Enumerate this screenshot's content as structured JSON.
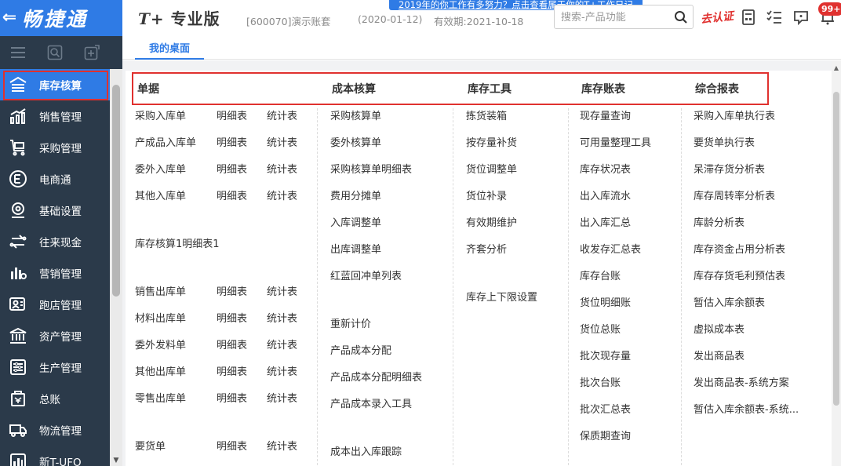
{
  "sidebar": {
    "logo_text": "畅捷通",
    "back_glyph": "⇐",
    "menu_items": [
      {
        "label": "库存核算",
        "icon": "warehouse-icon",
        "active": true
      },
      {
        "label": "销售管理",
        "icon": "sales-chart-icon",
        "active": false
      },
      {
        "label": "采购管理",
        "icon": "cart-icon",
        "active": false
      },
      {
        "label": "电商通",
        "icon": "ecommerce-icon",
        "active": false
      },
      {
        "label": "基础设置",
        "icon": "settings-icon",
        "active": false
      },
      {
        "label": "往来现金",
        "icon": "transfer-icon",
        "active": false
      },
      {
        "label": "营销管理",
        "icon": "marketing-icon",
        "active": false
      },
      {
        "label": "跑店管理",
        "icon": "store-visit-icon",
        "active": false
      },
      {
        "label": "资产管理",
        "icon": "bank-icon",
        "active": false
      },
      {
        "label": "生产管理",
        "icon": "production-icon",
        "active": false
      },
      {
        "label": "总账",
        "icon": "ledger-icon",
        "active": false
      },
      {
        "label": "物流管理",
        "icon": "truck-icon",
        "active": false
      },
      {
        "label": "新T-UFO",
        "icon": "report-icon",
        "active": false
      }
    ]
  },
  "header": {
    "product_title_prefix": "T+",
    "product_title_suffix": " 专业版",
    "account": "[600070]演示账套",
    "period": "(2020-01-12)",
    "expiry": "有效期:2021-10-18",
    "banner": "2019年的你工作有多努力？点击查看属于你的T+工作日记",
    "search_placeholder": "搜索-产品功能",
    "certify_label": "去认证",
    "notif_count": "99+"
  },
  "tabs": {
    "desktop": "我的桌面"
  },
  "columns": {
    "documents": {
      "title": "单据",
      "rows": [
        {
          "name": "采购入库单",
          "detail": "明细表",
          "stats": "统计表"
        },
        {
          "name": "产成品入库单",
          "detail": "明细表",
          "stats": "统计表"
        },
        {
          "name": "委外入库单",
          "detail": "明细表",
          "stats": "统计表"
        },
        {
          "name": "其他入库单",
          "detail": "明细表",
          "stats": "统计表"
        },
        {
          "name": "库存核算1明细表1",
          "detail": "",
          "stats": ""
        },
        {
          "name": "销售出库单",
          "detail": "明细表",
          "stats": "统计表"
        },
        {
          "name": "材料出库单",
          "detail": "明细表",
          "stats": "统计表"
        },
        {
          "name": "委外发料单",
          "detail": "明细表",
          "stats": "统计表"
        },
        {
          "name": "其他出库单",
          "detail": "明细表",
          "stats": "统计表"
        },
        {
          "name": "零售出库单",
          "detail": "明细表",
          "stats": "统计表"
        },
        {
          "name": "要货单",
          "detail": "明细表",
          "stats": "统计表"
        }
      ]
    },
    "cost": {
      "title": "成本核算",
      "items": [
        "采购核算单",
        "委外核算单",
        "采购核算单明细表",
        "费用分摊单",
        "入库调整单",
        "出库调整单",
        "红蓝回冲单列表",
        "重新计价",
        "产品成本分配",
        "产品成本分配明细表",
        "产品成本录入工具",
        "成本出入库跟踪"
      ]
    },
    "tools": {
      "title": "库存工具",
      "items": [
        "拣货装箱",
        "按存量补货",
        "货位调整单",
        "货位补录",
        "有效期维护",
        "齐套分析",
        "库存上下限设置"
      ]
    },
    "ledger": {
      "title": "库存账表",
      "items": [
        "现存量查询",
        "可用量整理工具",
        "库存状况表",
        "出入库流水",
        "出入库汇总",
        "收发存汇总表",
        "库存台账",
        "货位明细账",
        "货位总账",
        "批次现存量",
        "批次台账",
        "批次汇总表",
        "保质期查询"
      ]
    },
    "reports": {
      "title": "综合报表",
      "items": [
        "采购入库单执行表",
        "要货单执行表",
        "呆滞存货分析表",
        "库存周转率分析表",
        "库龄分析表",
        "库存资金占用分析表",
        "库存存货毛利预估表",
        "暂估入库余额表",
        "虚拟成本表",
        "发出商品表",
        "发出商品表-系统方案",
        "暂估入库余额表-系统..."
      ]
    }
  }
}
